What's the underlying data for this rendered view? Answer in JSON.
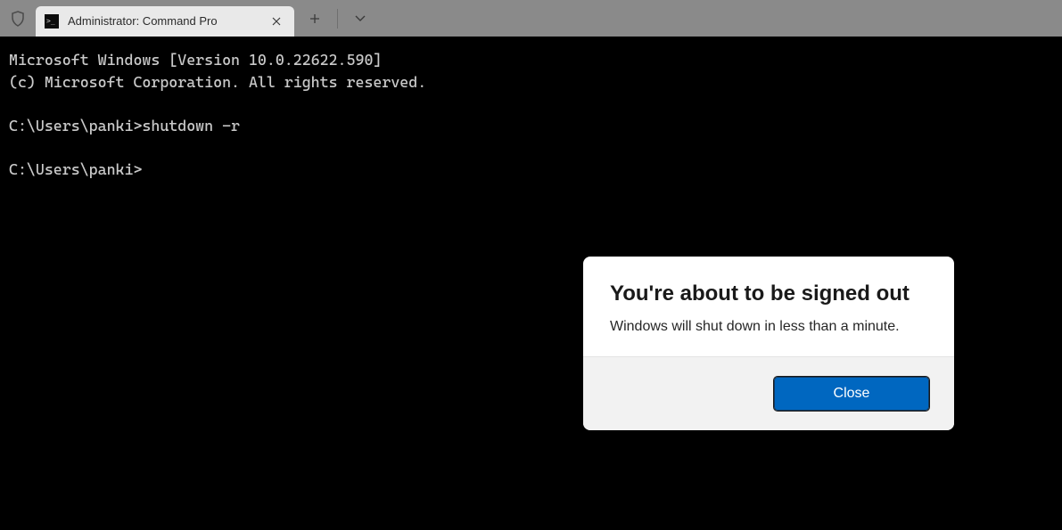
{
  "titlebar": {
    "tab_title": "Administrator: Command Pro",
    "tab_icon_glyph": ">_"
  },
  "terminal": {
    "line1": "Microsoft Windows [Version 10.0.22622.590]",
    "line2": "(c) Microsoft Corporation. All rights reserved.",
    "blank1": "",
    "line3": "C:\\Users\\panki>shutdown -r",
    "blank2": "",
    "line4": "C:\\Users\\panki>"
  },
  "dialog": {
    "title": "You're about to be signed out",
    "message": "Windows will shut down in less than a minute.",
    "close_label": "Close"
  }
}
